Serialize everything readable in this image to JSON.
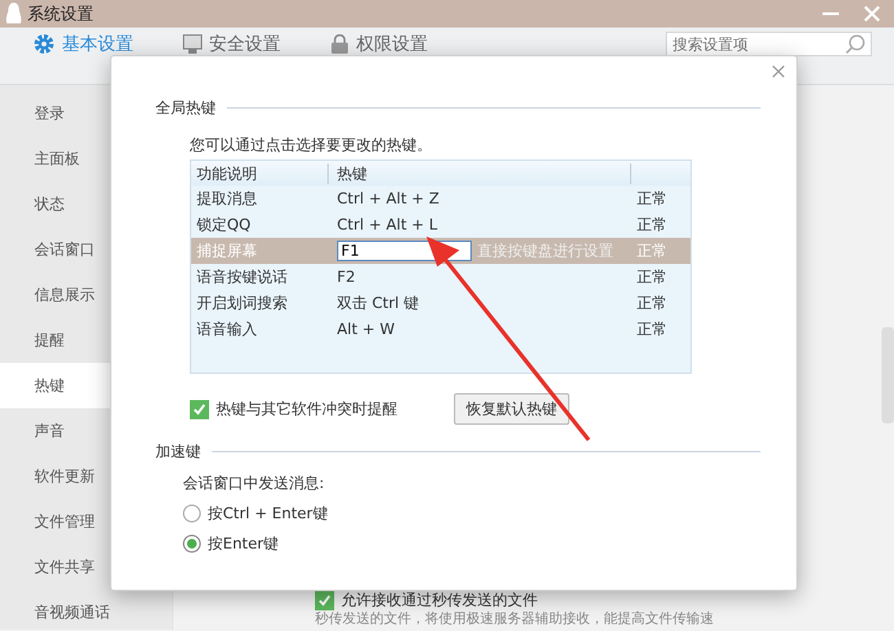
{
  "window": {
    "title": "系统设置"
  },
  "tabs": [
    {
      "label": "基本设置",
      "selected": true
    },
    {
      "label": "安全设置",
      "selected": false
    },
    {
      "label": "权限设置",
      "selected": false
    }
  ],
  "search": {
    "placeholder": "搜索设置项"
  },
  "sidebar": {
    "items": [
      {
        "label": "登录",
        "selected": false
      },
      {
        "label": "主面板",
        "selected": false
      },
      {
        "label": "状态",
        "selected": false
      },
      {
        "label": "会话窗口",
        "selected": false
      },
      {
        "label": "信息展示",
        "selected": false
      },
      {
        "label": "提醒",
        "selected": false
      },
      {
        "label": "热键",
        "selected": true
      },
      {
        "label": "声音",
        "selected": false
      },
      {
        "label": "软件更新",
        "selected": false
      },
      {
        "label": "文件管理",
        "selected": false
      },
      {
        "label": "文件共享",
        "selected": false
      },
      {
        "label": "音视频通话",
        "selected": false
      }
    ]
  },
  "background": {
    "checkbox": {
      "label": "允许接收通过秒传发送的文件",
      "checked": true
    },
    "description": "秒传发送的文件，将使用极速服务器辅助接收，能提高文件传输速"
  },
  "dialog": {
    "hotkey_section": {
      "title": "全局热键",
      "hint": "您可以通过点击选择要更改的热键。",
      "table": {
        "columns": [
          "功能说明",
          "热键"
        ],
        "rows": [
          {
            "function": "提取消息",
            "hotkey": "Ctrl + Alt + Z",
            "status": "正常",
            "selected": false
          },
          {
            "function": "锁定QQ",
            "hotkey": "Ctrl + Alt + L",
            "status": "正常",
            "selected": false
          },
          {
            "function": "捕捉屏幕",
            "hotkey": "F1",
            "input_hint": "直接按键盘进行设置",
            "status": "正常",
            "selected": true
          },
          {
            "function": "语音按键说话",
            "hotkey": "F2",
            "status": "正常",
            "selected": false
          },
          {
            "function": "开启划词搜索",
            "hotkey": "双击 Ctrl 键",
            "status": "正常",
            "selected": false
          },
          {
            "function": "语音输入",
            "hotkey": "Alt + W",
            "status": "正常",
            "selected": false
          }
        ]
      },
      "conflict_checkbox": {
        "label": "热键与其它软件冲突时提醒",
        "checked": true
      },
      "restore_button": "恢复默认热键"
    },
    "accelerator_section": {
      "title": "加速键",
      "label": "会话窗口中发送消息:",
      "options": [
        {
          "label": "按Ctrl + Enter键",
          "selected": false
        },
        {
          "label": "按Enter键",
          "selected": true
        }
      ]
    }
  }
}
